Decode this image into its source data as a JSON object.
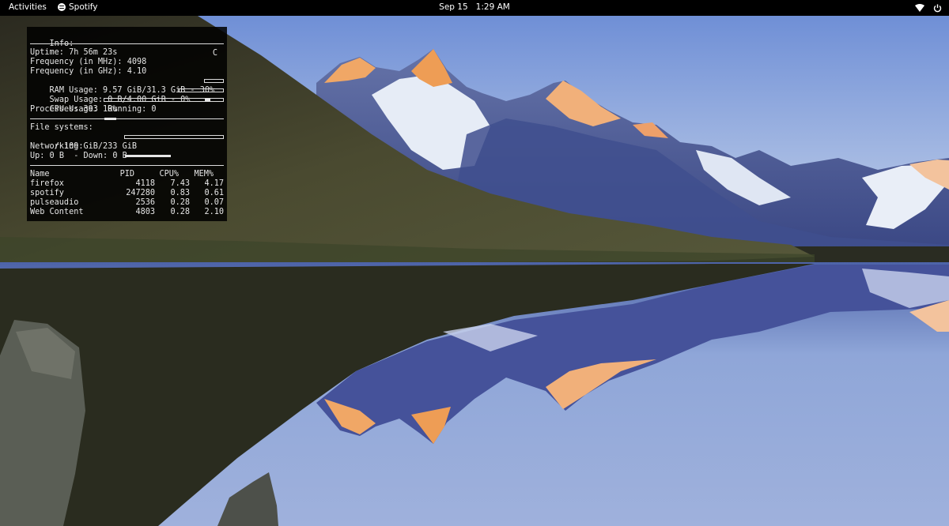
{
  "topbar": {
    "activities_label": "Activities",
    "app_name": "Spotify",
    "app_icon": "spotify-icon",
    "date": "Sep 15",
    "time": "1:29 AM",
    "tray_icons": [
      "wifi-icon",
      "power-icon"
    ]
  },
  "conky": {
    "header": {
      "label": "Info:",
      "right": "C"
    },
    "uptime": {
      "label": "Uptime:",
      "value": "7h 56m 23s"
    },
    "freq_mhz": {
      "label": "Frequency (in MHz):",
      "value": "4098"
    },
    "freq_ghz": {
      "label": "Frequency (in GHz):",
      "value": "4.10"
    },
    "ram": {
      "label": "RAM Usage:",
      "value": "9.57 GiB/31.3 GiB - 30%",
      "percent": 30
    },
    "swap": {
      "label": "Swap Usage:",
      "value": "0 B/4.00 GiB - 0%",
      "percent": 0
    },
    "cpu": {
      "label": "CPU Usage:",
      "value": "10%",
      "percent": 10
    },
    "processes": {
      "label": "Processes:",
      "value": "393",
      "running_label": "Running:",
      "running_value": "0"
    },
    "filesystems": {
      "label": "File systems:",
      "root": {
        "mount": "/",
        "value": "109 GiB/233 GiB",
        "percent": 47
      }
    },
    "networking": {
      "label": "Networking:",
      "up_label": "Up:",
      "up_value": "0 B",
      "down_label": "- Down:",
      "down_value": "0 B"
    },
    "top": {
      "headers": [
        "Name",
        "PID",
        "CPU%",
        "MEM%"
      ],
      "rows": [
        {
          "name": "firefox",
          "pid": "4118",
          "cpu": "7.43",
          "mem": "4.17"
        },
        {
          "name": "spotify",
          "pid": "247280",
          "cpu": "0.83",
          "mem": "0.61"
        },
        {
          "name": "pulseaudio",
          "pid": "2536",
          "cpu": "0.28",
          "mem": "0.07"
        },
        {
          "name": "Web Content",
          "pid": "4803",
          "cpu": "0.28",
          "mem": "2.10"
        }
      ]
    }
  },
  "wallpaper": {
    "subject": "mountain-lake-wallpaper",
    "colors": {
      "sky_top": "#6f8fd6",
      "sky_bottom": "#c9d6ea",
      "peaks_lit": "#f0a766",
      "hill": "#3a3a26",
      "water": "#8ea4d4"
    }
  }
}
